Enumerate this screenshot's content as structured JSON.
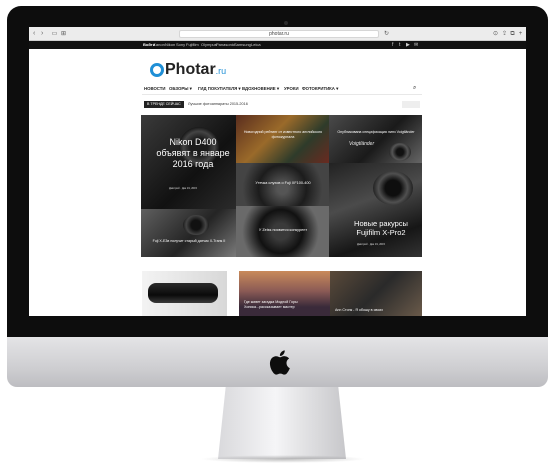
{
  "browser": {
    "url": "photar.ru",
    "nav_back": "‹",
    "nav_forward": "›",
    "icons": [
      "share-icon",
      "tabs-icon",
      "add-tab-icon"
    ]
  },
  "topbar": {
    "links": [
      "Войти",
      "Canon",
      "Nikon",
      "Sony",
      "Fujifilm",
      "Olympus",
      "Panasonic",
      "Samsung",
      "Leica"
    ],
    "social": [
      "f",
      "t",
      "▶",
      "✉"
    ]
  },
  "logo": {
    "name": "Photar",
    "tld": ".ru"
  },
  "menu": {
    "items": [
      "НОВОСТИ",
      "ОБЗОРЫ ▾",
      "ГИД ПОКУПАТЕЛЯ ▾",
      "ВДОХНОВЕНИЕ ▾",
      "УРОКИ",
      "ФОТОКРИТИКА ▾"
    ]
  },
  "trending": {
    "badge": "В ТРЕНДЕ СЕЙЧАС",
    "text": "Лучшие фотоаппараты 2015-2016"
  },
  "tiles": {
    "t1": {
      "title": "Nikon D400 объявят в январе 2016 года",
      "meta": "Дмитрий  ·  Дек 19, 2015"
    },
    "t2": {
      "title": "Новогодний рейтинг от известного английского фотожурнала"
    },
    "t3": {
      "title": "Опубликована спецификация линз Voigtländer",
      "brand": "Voigtländer"
    },
    "t4": {
      "title": "Утечка слухов о Fuji XF100-400"
    },
    "t5": {
      "title": "Новые ракурсы Fujifilm X-Pro2",
      "meta": "Дмитрий  ·  Дек 19, 2015"
    },
    "t6": {
      "title": "Fuji X-E3в получит старый датчик X-Trans II"
    },
    "t7": {
      "title": "У Zeiss появится конкурент"
    }
  },
  "bottom": {
    "b2": {
      "title": "Где живет загадка Модной Горы Хоника...рассказывает  мастер"
    },
    "b3": {
      "title": "Ann Стонк - Я обошу в своих"
    }
  }
}
